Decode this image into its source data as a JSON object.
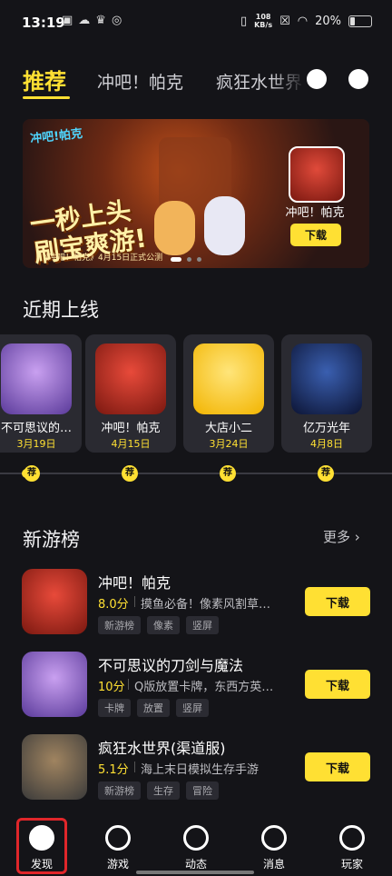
{
  "status": {
    "time": "13:19",
    "net_speed": "108\nKB/s",
    "battery": "20%"
  },
  "tabs": [
    {
      "label": "推荐"
    },
    {
      "label": "冲吧！帕克"
    },
    {
      "label": "疯狂水世界"
    }
  ],
  "banner": {
    "logo_text": "冲吧!帕克",
    "slogan_line1": "一秒上头",
    "slogan_line2": "刷宝爽游!",
    "caption": "《冲吧！帕克》4月15日正式公测",
    "app_name": "冲吧！帕克",
    "download_label": "下载"
  },
  "recent": {
    "title": "近期上线",
    "items": [
      {
        "name": "不可思议的…",
        "date": "3月19日",
        "badge": "荐"
      },
      {
        "name": "冲吧！帕克",
        "date": "4月15日",
        "badge": "荐"
      },
      {
        "name": "大店小二",
        "date": "3月24日",
        "badge": "荐"
      },
      {
        "name": "亿万光年",
        "date": "4月8日",
        "badge": "荐"
      }
    ]
  },
  "newgames": {
    "title": "新游榜",
    "more_label": "更多",
    "items": [
      {
        "name": "冲吧！帕克",
        "score": "8.0分",
        "desc": "摸鱼必备！像素风割草…",
        "tags": [
          "新游榜",
          "像素",
          "竖屏"
        ],
        "download_label": "下载"
      },
      {
        "name": "不可思议的刀剑与魔法",
        "score": "10分",
        "desc": "Q版放置卡牌，东西方英…",
        "tags": [
          "卡牌",
          "放置",
          "竖屏"
        ],
        "download_label": "下载"
      },
      {
        "name": "疯狂水世界(渠道服)",
        "score": "5.1分",
        "desc": "海上末日模拟生存手游",
        "tags": [
          "新游榜",
          "生存",
          "冒险"
        ],
        "download_label": "下载"
      }
    ]
  },
  "nav": [
    {
      "label": "发现"
    },
    {
      "label": "游戏"
    },
    {
      "label": "动态"
    },
    {
      "label": "消息"
    },
    {
      "label": "玩家"
    }
  ],
  "colors": {
    "accent": "#FFE033",
    "background": "#141418",
    "highlight": "#e0262a"
  }
}
